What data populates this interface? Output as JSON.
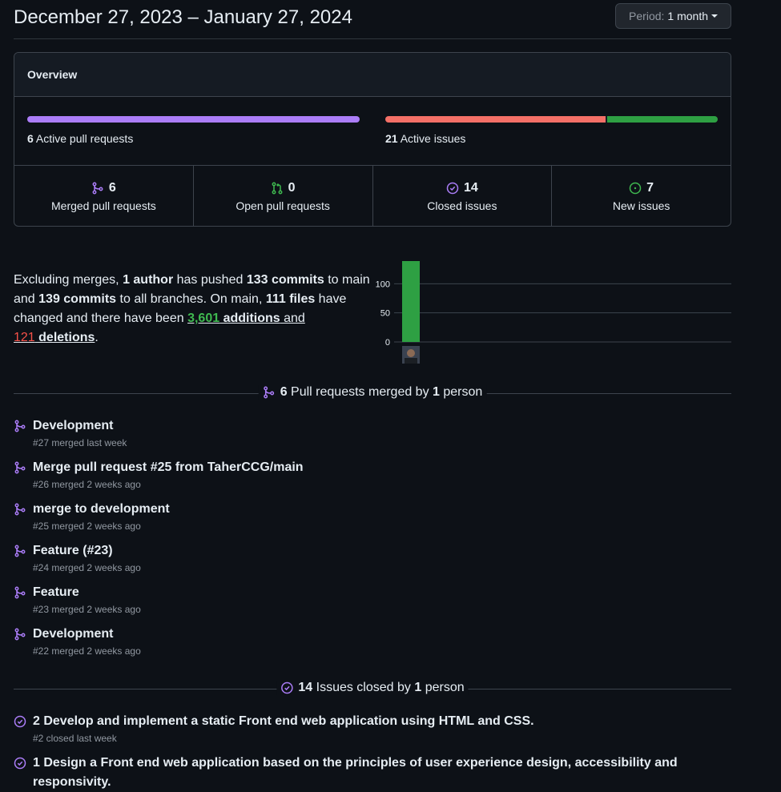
{
  "header": {
    "date_range": "December 27, 2023 – January 27, 2024",
    "period_label": "Period:",
    "period_value": "1 month"
  },
  "overview": {
    "title": "Overview",
    "active_prs": {
      "count": "6",
      "label": "Active pull requests",
      "merged_fraction": 1.0
    },
    "active_issues": {
      "count": "21",
      "label": "Active issues",
      "closed_fraction": 0.667,
      "new_fraction": 0.333
    },
    "stats": [
      {
        "num": "6",
        "label": "Merged pull requests",
        "icon": "git-merge-icon"
      },
      {
        "num": "0",
        "label": "Open pull requests",
        "icon": "git-pull-request-icon"
      },
      {
        "num": "14",
        "label": "Closed issues",
        "icon": "issue-closed-icon"
      },
      {
        "num": "7",
        "label": "New issues",
        "icon": "issue-opened-icon"
      }
    ]
  },
  "summary": {
    "t1": "Excluding merges, ",
    "authors": "1 author",
    "t2": " has pushed ",
    "commits_main": "133 commits",
    "t3": " to main and ",
    "commits_all": "139 commits",
    "t4": " to all branches. On main, ",
    "files": "111 files",
    "t5": " have changed and there have been ",
    "additions_num": "3,601",
    "additions_word": " additions",
    "t6": " and ",
    "deletions_num": "121",
    "deletions_word": " deletions",
    "t7": "."
  },
  "chart_data": {
    "type": "bar",
    "categories": [
      "author"
    ],
    "values": [
      139
    ],
    "ylim": [
      0,
      139
    ],
    "yticks": [
      "100",
      "50",
      "0"
    ],
    "ytick_values": [
      100,
      50,
      0
    ],
    "color": "#2ea043"
  },
  "prs_section": {
    "count": "6",
    "t1": " Pull requests merged by ",
    "people": "1",
    "t2": " person"
  },
  "prs": [
    {
      "title": "Development",
      "sub": "#27 merged last week"
    },
    {
      "title": "Merge pull request #25 from TaherCCG/main",
      "sub": "#26 merged 2 weeks ago"
    },
    {
      "title": "merge to development",
      "sub": "#25 merged 2 weeks ago"
    },
    {
      "title": "Feature (#23)",
      "sub": "#24 merged 2 weeks ago"
    },
    {
      "title": "Feature",
      "sub": "#23 merged 2 weeks ago"
    },
    {
      "title": "Development",
      "sub": "#22 merged 2 weeks ago"
    }
  ],
  "issues_section": {
    "count": "14",
    "t1": " Issues closed by ",
    "people": "1",
    "t2": " person"
  },
  "issues": [
    {
      "title": "2 Develop and implement a static Front end web application using HTML and CSS.",
      "sub": "#2 closed last week"
    },
    {
      "title": "1 Design a Front end web application based on the principles of user experience design, accessibility and responsivity.",
      "sub": ""
    }
  ],
  "colors": {
    "purple": "#ab7df8",
    "green": "#2ea043",
    "green_text": "#3fb950",
    "red": "#f85149",
    "issue_red": "#f47067"
  }
}
